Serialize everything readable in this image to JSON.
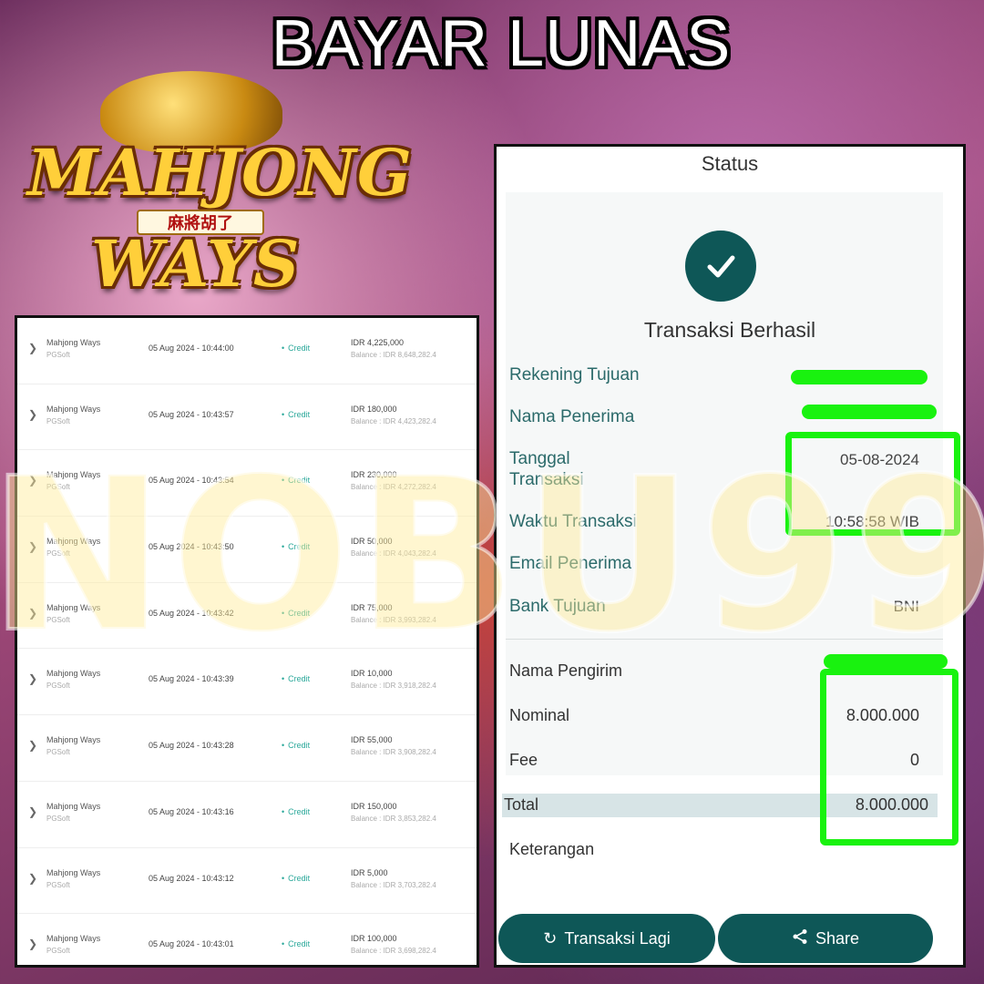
{
  "headline": "BAYAR LUNAS",
  "logo": {
    "line1": "MAHJONG",
    "line2": "WAYS",
    "chinese": "麻將胡了"
  },
  "history": {
    "rows": [
      {
        "game": "Mahjong Ways",
        "provider": "PGSoft",
        "datetime": "05 Aug 2024 - 10:44:00",
        "type": "Credit",
        "amount": "IDR 4,225,000",
        "balance": "Balance : IDR 8,648,282.4"
      },
      {
        "game": "Mahjong Ways",
        "provider": "PGSoft",
        "datetime": "05 Aug 2024 - 10:43:57",
        "type": "Credit",
        "amount": "IDR 180,000",
        "balance": "Balance : IDR 4,423,282.4"
      },
      {
        "game": "Mahjong Ways",
        "provider": "PGSoft",
        "datetime": "05 Aug 2024 - 10:43:54",
        "type": "Credit",
        "amount": "IDR 230,000",
        "balance": "Balance : IDR 4,272,282.4"
      },
      {
        "game": "Mahjong Ways",
        "provider": "PGSoft",
        "datetime": "05 Aug 2024 - 10:43:50",
        "type": "Credit",
        "amount": "IDR 50,000",
        "balance": "Balance : IDR 4,043,282.4"
      },
      {
        "game": "Mahjong Ways",
        "provider": "PGSoft",
        "datetime": "05 Aug 2024 - 10:43:42",
        "type": "Credit",
        "amount": "IDR 75,000",
        "balance": "Balance : IDR 3,993,282.4"
      },
      {
        "game": "Mahjong Ways",
        "provider": "PGSoft",
        "datetime": "05 Aug 2024 - 10:43:39",
        "type": "Credit",
        "amount": "IDR 10,000",
        "balance": "Balance : IDR 3,918,282.4"
      },
      {
        "game": "Mahjong Ways",
        "provider": "PGSoft",
        "datetime": "05 Aug 2024 - 10:43:28",
        "type": "Credit",
        "amount": "IDR 55,000",
        "balance": "Balance : IDR 3,908,282.4"
      },
      {
        "game": "Mahjong Ways",
        "provider": "PGSoft",
        "datetime": "05 Aug 2024 - 10:43:16",
        "type": "Credit",
        "amount": "IDR 150,000",
        "balance": "Balance : IDR 3,853,282.4"
      },
      {
        "game": "Mahjong Ways",
        "provider": "PGSoft",
        "datetime": "05 Aug 2024 - 10:43:12",
        "type": "Credit",
        "amount": "IDR 5,000",
        "balance": "Balance : IDR 3,703,282.4"
      },
      {
        "game": "Mahjong Ways",
        "provider": "PGSoft",
        "datetime": "05 Aug 2024 - 10:43:01",
        "type": "Credit",
        "amount": "IDR 100,000",
        "balance": "Balance : IDR 3,698,282.4"
      }
    ]
  },
  "receipt": {
    "status": "Status",
    "result_title": "Transaksi Berhasil",
    "fields": {
      "rekening_tujuan": "Rekening Tujuan",
      "nama_penerima": "Nama Penerima",
      "tanggal_transaksi_line1": "Tanggal",
      "tanggal_transaksi_line2": "Transaksi",
      "tanggal_value": "05-08-2024",
      "waktu_transaksi": "Waktu Transaksi",
      "waktu_value": "10:58:58 WIB",
      "email_penerima": "Email Penerima",
      "bank_tujuan": "Bank Tujuan",
      "bank_value": "BNI",
      "nama_pengirim": "Nama Pengirim",
      "nominal": "Nominal",
      "nominal_value": "8.000.000",
      "fee": "Fee",
      "fee_value": "0",
      "total": "Total",
      "total_value": "8.000.000",
      "keterangan": "Keterangan"
    },
    "buttons": {
      "again": "Transaksi Lagi",
      "share": "Share"
    }
  },
  "watermark": "NOBU99",
  "colors": {
    "accent": "#0e5757",
    "highlight": "#19f20f",
    "credit": "#2aa89a"
  }
}
